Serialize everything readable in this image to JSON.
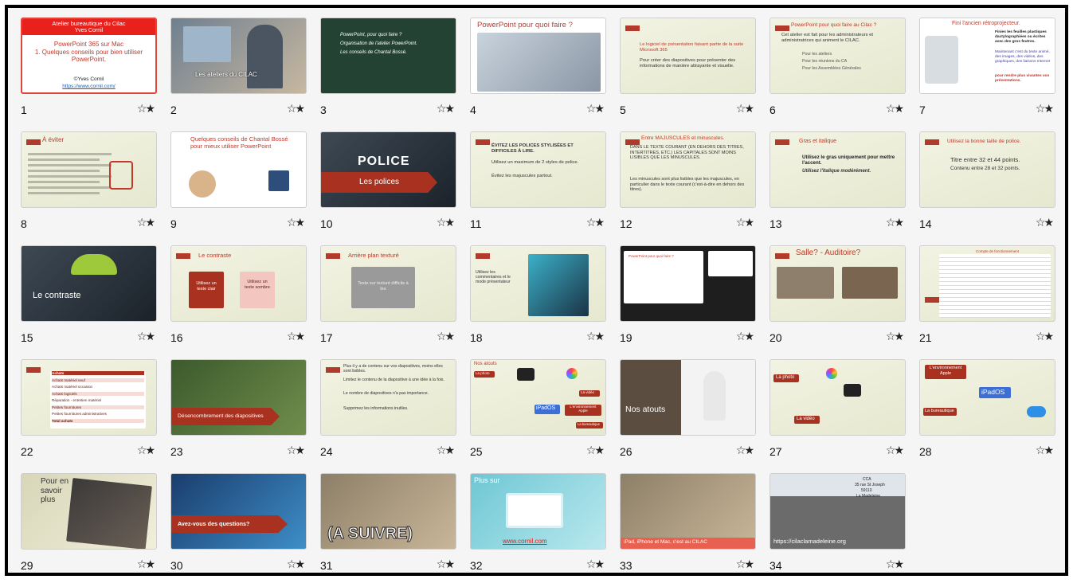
{
  "slides": [
    {
      "num": "1",
      "theme": "red",
      "selected": true,
      "lines": [
        "Atelier bureautique du Cilac",
        "Yves Cornil",
        "PowerPoint 365 sur Mac",
        "1. Quelques conseils pour bien utiliser PowerPoint.",
        "©Yves Cornil",
        "https://www.cornil.com/"
      ]
    },
    {
      "num": "2",
      "theme": "photo",
      "lines": [
        "Les ateliers du CILAC"
      ]
    },
    {
      "num": "3",
      "theme": "dark",
      "lines": [
        "PowerPoint, pour quoi faire ?",
        "Organisation de l'atelier PowerPoint.",
        "Les conseils de Chantal Bossé."
      ]
    },
    {
      "num": "4",
      "theme": "white",
      "lines": [
        "PowerPoint pour quoi faire ?"
      ]
    },
    {
      "num": "5",
      "theme": "green",
      "lines": [
        "Le logiciel de présentation faisant partie de la suite Microsoft 365",
        "Pour créer des diapositives pour présenter des informations de manière attrayante et visuelle."
      ]
    },
    {
      "num": "6",
      "theme": "green",
      "lines": [
        "PowerPoint pour quoi faire au Cilac ?",
        "Cet atelier est fait pour les administrateurs et administratrices qui animent le CILAC.",
        "Pour les ateliers",
        "Pour les réunions du CA",
        "Pour les Assemblées Générales"
      ]
    },
    {
      "num": "7",
      "theme": "white",
      "lines": [
        "Fini l'ancien rétroprojecteur.",
        "Finies les feuilles plastiques dactylographiées ou écrites avec des gros feutres.",
        "Maintenant c'est du texte animé, des images, des vidéos, des graphiques, des liaisons Internet",
        "pour rendre plus vivantes vos présentations."
      ]
    },
    {
      "num": "8",
      "theme": "green",
      "lines": [
        "À éviter"
      ]
    },
    {
      "num": "9",
      "theme": "white",
      "lines": [
        "Quelques conseils de Chantal Bossé pour mieux utiliser PowerPoint"
      ]
    },
    {
      "num": "10",
      "theme": "grey",
      "lines": [
        "POLICE",
        "Les polices"
      ]
    },
    {
      "num": "11",
      "theme": "green",
      "lines": [
        "ÉVITEZ LES POLICES STYLISÉES ET DIFFICILES À LIRE.",
        "Utilisez un maximum de 2 styles de police.",
        "Évitez les majuscules partout."
      ]
    },
    {
      "num": "12",
      "theme": "green",
      "lines": [
        "Entre MAJUSCULES et minuscules.",
        "DANS LE TEXTE COURANT (EN DEHORS DES TITRES, INTERTITRES, ETC.) LES CAPITALES SONT MOINS LISIBLES QUE LES MINUSCULES.",
        "Les minuscules sont plus lisibles que les majuscules, en particulier dans le texte courant (c'est-à-dire en dehors des titres)."
      ]
    },
    {
      "num": "13",
      "theme": "green",
      "lines": [
        "Gras et italique",
        "Utilisez le gras uniquement pour mettre l'accent.",
        "Utilisez l'italique modérément."
      ]
    },
    {
      "num": "14",
      "theme": "green",
      "lines": [
        "Utilisez la bonne taille de police.",
        "Titre entre 32 et 44 points.",
        "Contenu entre 28 et 32 points."
      ]
    },
    {
      "num": "15",
      "theme": "grey",
      "lines": [
        "Le contraste"
      ]
    },
    {
      "num": "16",
      "theme": "green",
      "lines": [
        "Le contraste",
        "Utilisez un texte clair",
        "Utilisez un texte sombre"
      ]
    },
    {
      "num": "17",
      "theme": "green",
      "lines": [
        "Arrière plan texturé",
        "Texte sur texturé difficile à lire"
      ]
    },
    {
      "num": "18",
      "theme": "green",
      "lines": [
        "Utilisez les commentaires et le mode présentateur"
      ]
    },
    {
      "num": "19",
      "theme": "black",
      "lines": [
        "PowerPoint pour quoi faire ?"
      ]
    },
    {
      "num": "20",
      "theme": "green",
      "lines": [
        "Salle? -  Auditoire?"
      ]
    },
    {
      "num": "21",
      "theme": "green",
      "lines": [
        "Compte de fonctionnement"
      ]
    },
    {
      "num": "22",
      "theme": "green",
      "lines": [
        "Achats",
        "Achats matériel neuf",
        "Achats matériel occasion",
        "Achats logiciels",
        "Réparation - entretien matériel",
        "Petites fournitures",
        "Petites fournitures administratives",
        "Total achats"
      ]
    },
    {
      "num": "23",
      "theme": "road",
      "lines": [
        "Désencombrement des diapositives"
      ]
    },
    {
      "num": "24",
      "theme": "green",
      "lines": [
        "Plus il y a de contenu sur vos diapositives, moins elles sont lisibles.",
        "Limitez le contenu de la diapositive à une idée à la fois.",
        "Le nombre de diapositives n'a pas importance.",
        "Supprimez les informations inutiles."
      ]
    },
    {
      "num": "25",
      "theme": "green",
      "lines": [
        "Nos atouts",
        "La photo",
        "La vidéo",
        "iPadOS",
        "L'environnement Apple",
        "La bureautique"
      ]
    },
    {
      "num": "26",
      "theme": "brown",
      "lines": [
        "Nos atouts"
      ]
    },
    {
      "num": "27",
      "theme": "green",
      "lines": [
        "La photo",
        "La vidéo"
      ]
    },
    {
      "num": "28",
      "theme": "green",
      "lines": [
        "L'environnement Apple",
        "iPadOS",
        "La bureautique"
      ]
    },
    {
      "num": "29",
      "theme": "book",
      "lines": [
        "Pour en savoir plus"
      ]
    },
    {
      "num": "30",
      "theme": "blue",
      "lines": [
        "Avez-vous des questions?"
      ]
    },
    {
      "num": "31",
      "theme": "people",
      "lines": [
        "(A SUIVRE)"
      ]
    },
    {
      "num": "32",
      "theme": "cyan",
      "lines": [
        "Plus sur",
        "www.cornil.com"
      ]
    },
    {
      "num": "33",
      "theme": "people",
      "lines": [
        "iPad, iPhone et Mac, c'est au CILAC"
      ]
    },
    {
      "num": "34",
      "theme": "building",
      "lines": [
        "CCA",
        "35 rue St Joseph",
        "59110",
        "La Madeleine",
        "https://cilaclamadeleine.org"
      ]
    }
  ],
  "star_glyph": "☆★"
}
